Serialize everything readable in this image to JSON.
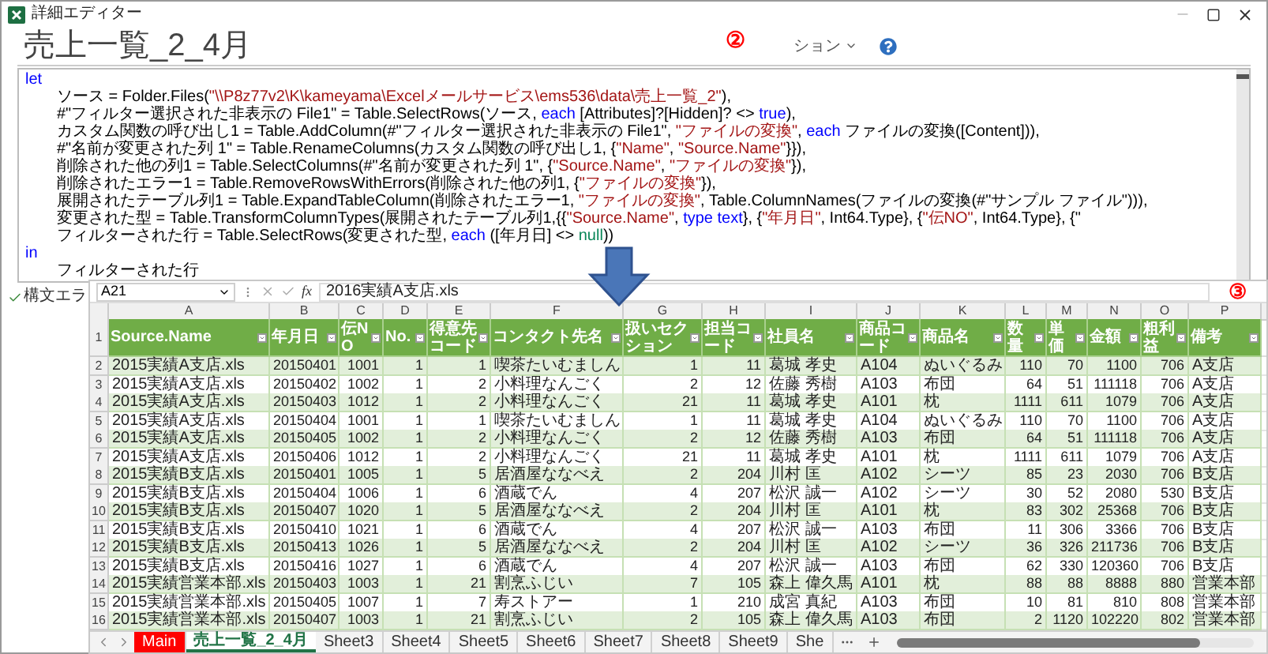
{
  "editor": {
    "window_title": "詳細エディター",
    "query_title": "売上一覧_2_4月",
    "annotation": "②",
    "options_label": "ション",
    "code": [
      {
        "keyword": "let",
        "lines": [
          [
            {
              "kind": "plain",
              "text": "ソース = Folder.Files("
            },
            {
              "kind": "string",
              "text": "\"\\\\P8z77v2\\K\\kameyama\\Excelメールサービス\\ems536\\data\\売上一覧_2\""
            },
            {
              "kind": "plain",
              "text": "),"
            }
          ],
          [
            {
              "kind": "plain",
              "text": "#\"フィルター選択された非表示の File1\" = Table.SelectRows(ソース, "
            },
            {
              "kind": "keyword",
              "text": "each"
            },
            {
              "kind": "plain",
              "text": " [Attributes]?[Hidden]? <> "
            },
            {
              "kind": "keyword",
              "text": "true"
            },
            {
              "kind": "plain",
              "text": "),"
            }
          ],
          [
            {
              "kind": "plain",
              "text": "カスタム関数の呼び出し1 = Table.AddColumn(#\"フィルター選択された非表示の File1\", "
            },
            {
              "kind": "string",
              "text": "\"ファイルの変換\""
            },
            {
              "kind": "plain",
              "text": ", "
            },
            {
              "kind": "keyword",
              "text": "each"
            },
            {
              "kind": "plain",
              "text": " ファイルの変換([Content])),"
            }
          ],
          [
            {
              "kind": "plain",
              "text": "#\"名前が変更された列 1\" = Table.RenameColumns(カスタム関数の呼び出し1, {"
            },
            {
              "kind": "string",
              "text": "\"Name\""
            },
            {
              "kind": "plain",
              "text": ", "
            },
            {
              "kind": "string",
              "text": "\"Source.Name\""
            },
            {
              "kind": "plain",
              "text": "}}),"
            }
          ],
          [
            {
              "kind": "plain",
              "text": "削除された他の列1 = Table.SelectColumns(#\"名前が変更された列 1\", {"
            },
            {
              "kind": "string",
              "text": "\"Source.Name\""
            },
            {
              "kind": "plain",
              "text": ", "
            },
            {
              "kind": "string",
              "text": "\"ファイルの変換\""
            },
            {
              "kind": "plain",
              "text": "}),"
            }
          ],
          [
            {
              "kind": "plain",
              "text": "削除されたエラー1 = Table.RemoveRowsWithErrors(削除された他の列1, {"
            },
            {
              "kind": "string",
              "text": "\"ファイルの変換\""
            },
            {
              "kind": "plain",
              "text": "}),"
            }
          ],
          [
            {
              "kind": "plain",
              "text": "展開されたテーブル列1 = Table.ExpandTableColumn(削除されたエラー1, "
            },
            {
              "kind": "string",
              "text": "\"ファイルの変換\""
            },
            {
              "kind": "plain",
              "text": ", Table.ColumnNames(ファイルの変換(#\"サンプル ファイル\"))),"
            }
          ],
          [
            {
              "kind": "plain",
              "text": "変更された型 = Table.TransformColumnTypes(展開されたテーブル列1,{{"
            },
            {
              "kind": "string",
              "text": "\"Source.Name\""
            },
            {
              "kind": "plain",
              "text": ", "
            },
            {
              "kind": "keyword",
              "text": "type text"
            },
            {
              "kind": "plain",
              "text": "}, {"
            },
            {
              "kind": "string",
              "text": "\"年月日\""
            },
            {
              "kind": "plain",
              "text": ", Int64.Type}, {"
            },
            {
              "kind": "string",
              "text": "\"伝NO\""
            },
            {
              "kind": "plain",
              "text": ", Int64.Type}, {\""
            }
          ],
          [
            {
              "kind": "plain",
              "text": "フィルターされた行 = Table.SelectRows(変更された型, "
            },
            {
              "kind": "keyword",
              "text": "each"
            },
            {
              "kind": "plain",
              "text": " ([年月日] <> "
            },
            {
              "kind": "literal",
              "text": "null"
            },
            {
              "kind": "plain",
              "text": "))"
            }
          ]
        ]
      },
      {
        "keyword": "in",
        "lines": [
          [
            {
              "kind": "plain",
              "text": "フィルターされた行"
            }
          ]
        ]
      }
    ],
    "status": "構文エラ"
  },
  "sheet": {
    "name_box": "A21",
    "fx": "fx",
    "formula": "2016実績A支店.xls",
    "annotation": "③",
    "header_row": "1",
    "columns": [
      {
        "letter": "A",
        "header": "Source.Name",
        "kind": "text"
      },
      {
        "letter": "B",
        "header": "年月日",
        "kind": "number"
      },
      {
        "letter": "C",
        "header": "伝NO",
        "kind": "number"
      },
      {
        "letter": "D",
        "header": "No.",
        "kind": "number"
      },
      {
        "letter": "E",
        "header": "得意先コード",
        "kind": "number"
      },
      {
        "letter": "F",
        "header": "コンタクト先名",
        "kind": "text"
      },
      {
        "letter": "G",
        "header": "扱いセクション",
        "kind": "number"
      },
      {
        "letter": "H",
        "header": "担当コード",
        "kind": "number"
      },
      {
        "letter": "I",
        "header": "社員名",
        "kind": "text"
      },
      {
        "letter": "J",
        "header": "商品コード",
        "kind": "text"
      },
      {
        "letter": "K",
        "header": "商品名",
        "kind": "text"
      },
      {
        "letter": "L",
        "header": "数量",
        "kind": "number"
      },
      {
        "letter": "M",
        "header": "単価",
        "kind": "number"
      },
      {
        "letter": "N",
        "header": "金額",
        "kind": "number"
      },
      {
        "letter": "O",
        "header": "粗利益",
        "kind": "number"
      },
      {
        "letter": "P",
        "header": "備考",
        "kind": "text"
      }
    ],
    "rows": [
      {
        "number": "2",
        "cells": [
          "2015実績A支店.xls",
          "20150401",
          "1001",
          "1",
          "1",
          "喫茶たいむましん",
          "1",
          "11",
          "葛城 孝史",
          "A104",
          "ぬいぐるみ",
          "110",
          "70",
          "1100",
          "706",
          "A支店"
        ]
      },
      {
        "number": "3",
        "cells": [
          "2015実績A支店.xls",
          "20150402",
          "1002",
          "1",
          "2",
          "小料理なんごく",
          "2",
          "12",
          "佐藤 秀樹",
          "A103",
          "布団",
          "64",
          "51",
          "111118",
          "706",
          "A支店"
        ]
      },
      {
        "number": "4",
        "cells": [
          "2015実績A支店.xls",
          "20150403",
          "1012",
          "1",
          "2",
          "小料理なんごく",
          "21",
          "11",
          "葛城 孝史",
          "A101",
          "枕",
          "1111",
          "611",
          "1079",
          "706",
          "A支店"
        ]
      },
      {
        "number": "5",
        "cells": [
          "2015実績A支店.xls",
          "20150404",
          "1001",
          "1",
          "1",
          "喫茶たいむましん",
          "1",
          "11",
          "葛城 孝史",
          "A104",
          "ぬいぐるみ",
          "110",
          "70",
          "1100",
          "706",
          "A支店"
        ]
      },
      {
        "number": "6",
        "cells": [
          "2015実績A支店.xls",
          "20150405",
          "1002",
          "1",
          "2",
          "小料理なんごく",
          "2",
          "12",
          "佐藤 秀樹",
          "A103",
          "布団",
          "64",
          "51",
          "111118",
          "706",
          "A支店"
        ]
      },
      {
        "number": "7",
        "cells": [
          "2015実績A支店.xls",
          "20150406",
          "1012",
          "1",
          "2",
          "小料理なんごく",
          "21",
          "11",
          "葛城 孝史",
          "A101",
          "枕",
          "1111",
          "611",
          "1079",
          "706",
          "A支店"
        ]
      },
      {
        "number": "8",
        "cells": [
          "2015実績B支店.xls",
          "20150401",
          "1005",
          "1",
          "5",
          "居酒屋ななべえ",
          "2",
          "204",
          "川村 匡",
          "A102",
          "シーツ",
          "85",
          "23",
          "2030",
          "706",
          "B支店"
        ]
      },
      {
        "number": "9",
        "cells": [
          "2015実績B支店.xls",
          "20150404",
          "1006",
          "1",
          "6",
          "酒蔵でん",
          "4",
          "207",
          "松沢 誠一",
          "A102",
          "シーツ",
          "30",
          "52",
          "2080",
          "530",
          "B支店"
        ]
      },
      {
        "number": "10",
        "cells": [
          "2015実績B支店.xls",
          "20150407",
          "1020",
          "1",
          "5",
          "居酒屋ななべえ",
          "2",
          "204",
          "川村 匡",
          "A101",
          "枕",
          "83",
          "302",
          "25368",
          "706",
          "B支店"
        ]
      },
      {
        "number": "11",
        "cells": [
          "2015実績B支店.xls",
          "20150410",
          "1021",
          "1",
          "6",
          "酒蔵でん",
          "4",
          "207",
          "松沢 誠一",
          "A103",
          "布団",
          "11",
          "306",
          "3366",
          "706",
          "B支店"
        ]
      },
      {
        "number": "12",
        "cells": [
          "2015実績B支店.xls",
          "20150413",
          "1026",
          "1",
          "5",
          "居酒屋ななべえ",
          "2",
          "204",
          "川村 匡",
          "A102",
          "シーツ",
          "36",
          "326",
          "211736",
          "706",
          "B支店"
        ]
      },
      {
        "number": "13",
        "cells": [
          "2015実績B支店.xls",
          "20150416",
          "1027",
          "1",
          "6",
          "酒蔵でん",
          "4",
          "207",
          "松沢 誠一",
          "A103",
          "布団",
          "62",
          "330",
          "120360",
          "706",
          "B支店"
        ]
      },
      {
        "number": "14",
        "cells": [
          "2015実績営業本部.xls",
          "20150403",
          "1003",
          "1",
          "21",
          "割烹ふじい",
          "7",
          "105",
          "森上 偉久馬",
          "A101",
          "枕",
          "88",
          "88",
          "8888",
          "880",
          "営業本部"
        ]
      },
      {
        "number": "15",
        "cells": [
          "2015実績営業本部.xls",
          "20150405",
          "1007",
          "1",
          "7",
          "寿ストアー",
          "1",
          "210",
          "成宮 真紀",
          "A103",
          "布団",
          "10",
          "81",
          "810",
          "808",
          "営業本部"
        ]
      },
      {
        "number": "16",
        "cells": [
          "2015実績営業本部.xls",
          "20150407",
          "1003",
          "1",
          "21",
          "割烹ふじい",
          "2",
          "105",
          "森上 偉久馬",
          "A103",
          "布団",
          "2",
          "1120",
          "102220",
          "802",
          "営業本部"
        ]
      }
    ],
    "tabs": [
      {
        "label": "Main",
        "selected": false,
        "color": "#ff0000"
      },
      {
        "label": "売上一覧_2_4月",
        "selected": true
      },
      {
        "label": "Sheet3",
        "selected": false
      },
      {
        "label": "Sheet4",
        "selected": false
      },
      {
        "label": "Sheet5",
        "selected": false
      },
      {
        "label": "Sheet6",
        "selected": false
      },
      {
        "label": "Sheet7",
        "selected": false
      },
      {
        "label": "Sheet8",
        "selected": false
      },
      {
        "label": "Sheet9",
        "selected": false
      },
      {
        "label": "She",
        "selected": false
      }
    ]
  }
}
